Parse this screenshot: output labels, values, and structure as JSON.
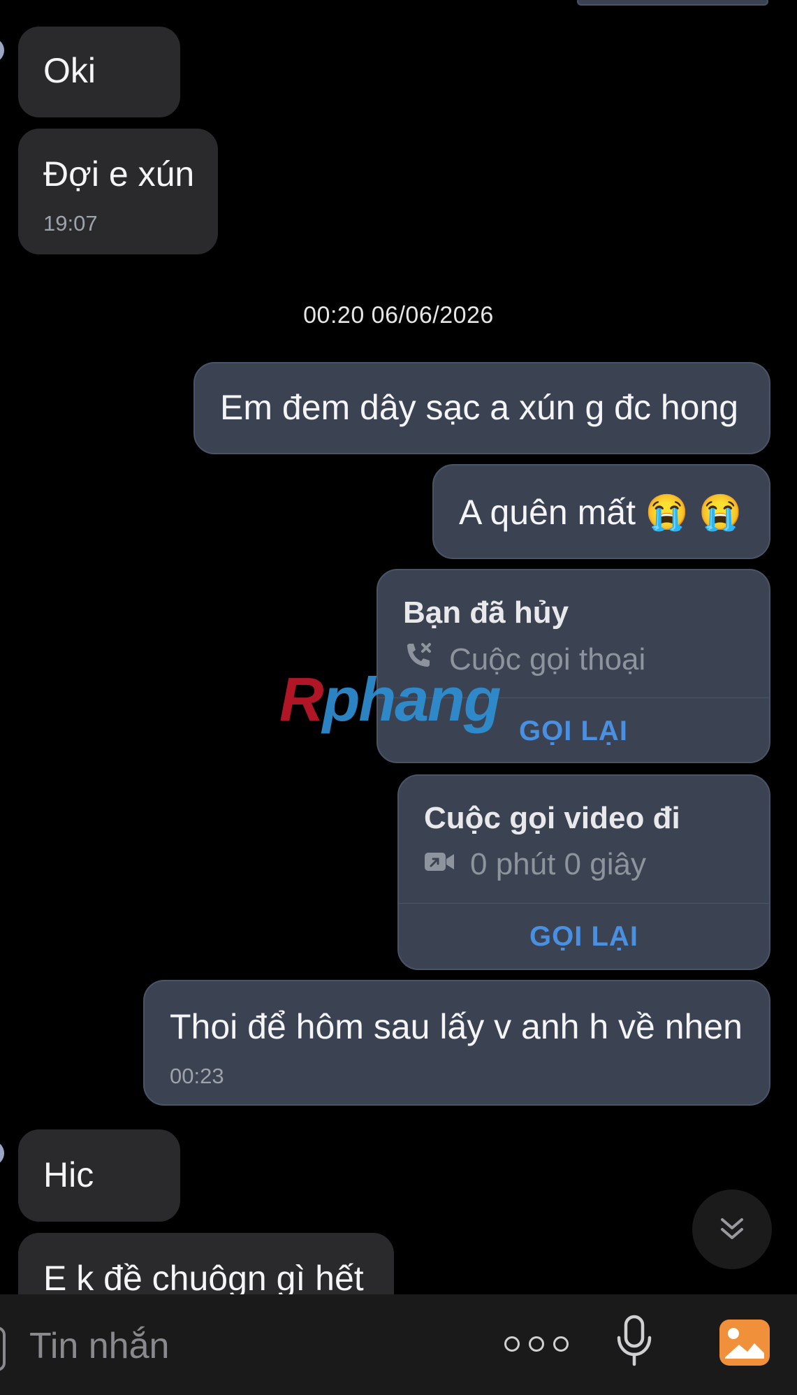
{
  "messages": {
    "m1": {
      "text": "Oki"
    },
    "m2": {
      "text": "Đợi e xún",
      "time": "19:07"
    },
    "divider": "00:20 06/06/2026",
    "m3": {
      "text": "Em đem dây sạc a xún g đc hong"
    },
    "m4": {
      "text": "A quên mất",
      "emoji": "😭 😭"
    },
    "call1": {
      "title": "Bạn đã hủy",
      "subtitle": "Cuộc gọi thoại",
      "action": "GỌI LẠI"
    },
    "call2": {
      "title": "Cuộc gọi video đi",
      "subtitle": "0 phút 0 giây",
      "action": "GỌI LẠI"
    },
    "m5": {
      "text": "Thoi để hôm sau lấy v anh h về nhen",
      "time": "00:23"
    },
    "m6": {
      "text": "Hic"
    },
    "m7": {
      "text": "E k đề chuôgn gì hết"
    }
  },
  "watermark": {
    "text_r": "R",
    "text_rest": "phang"
  },
  "composer": {
    "placeholder": "Tin nhắn"
  },
  "icons": {
    "scroll_down": "double-chevron-down-icon",
    "more": "more-dots-icon",
    "mic": "microphone-icon",
    "gallery": "image-gallery-icon",
    "missed_call": "missed-call-icon",
    "video_call": "video-call-icon"
  },
  "colors": {
    "incoming_bubble": "#2a2a2c",
    "outgoing_bubble": "#3b4352",
    "link_blue": "#4a90e2",
    "gallery_orange": "#f0903a"
  }
}
